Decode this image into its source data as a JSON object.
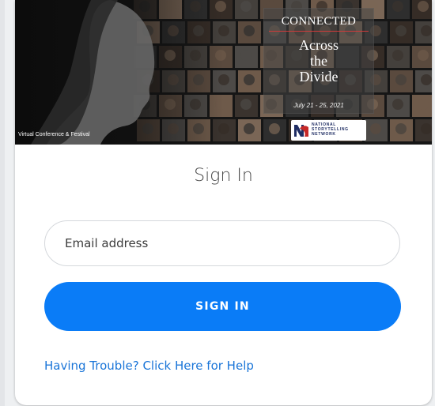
{
  "banner": {
    "connected": "CONNECTED",
    "headline_lines": [
      "Across",
      "the",
      "Divide"
    ],
    "dates": "July 21 - 25, 2021",
    "subtitle": "Virtual Conference & Festival",
    "logo_lines": [
      "NATIONAL",
      "STORYTELLING",
      "NETWORK"
    ]
  },
  "form": {
    "heading": "Sign In",
    "email_placeholder": "Email address",
    "email_value": "",
    "signin_label": "SIGN IN",
    "help_link": "Having Trouble? Click Here for Help"
  },
  "colors": {
    "accent": "#0a7cf7",
    "link": "#1a75d8",
    "banner_line": "#d23a3a",
    "logo_navy": "#1f2d63",
    "logo_red": "#c62828"
  }
}
